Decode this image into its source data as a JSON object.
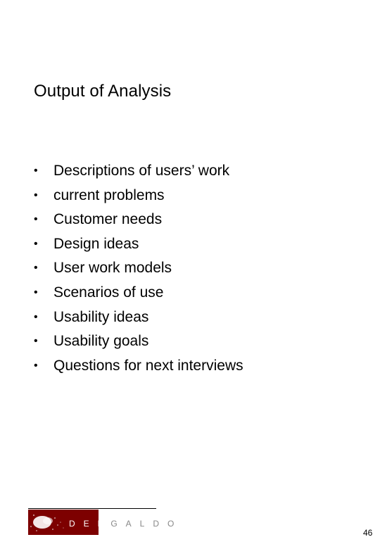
{
  "slide": {
    "title": "Output of Analysis",
    "bullets": [
      "Descriptions of users’ work",
      "current problems",
      "Customer needs",
      "Design ideas",
      "User work models",
      "Scenarios of use",
      "Usability ideas",
      "Usability goals",
      "Questions for next interviews"
    ],
    "bullet_glyph": "•"
  },
  "footer": {
    "logo_icon": "delgaldo-logo-icon",
    "logo_text_part1": "DEL",
    "logo_text_part2": "GALDO",
    "brand_color": "#7d0000",
    "page_number": "46"
  }
}
